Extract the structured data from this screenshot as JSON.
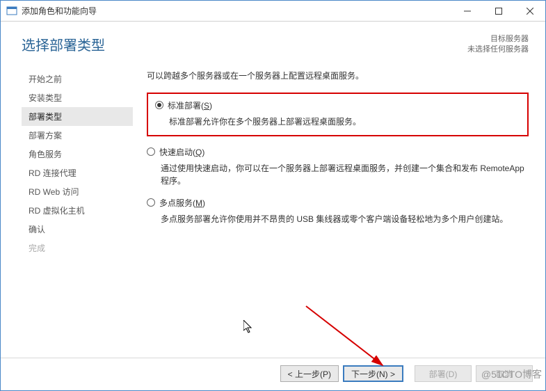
{
  "window": {
    "title": "添加角色和功能向导"
  },
  "header": {
    "page_title": "选择部署类型",
    "target_label": "目标服务器",
    "target_value": "未选择任何服务器"
  },
  "sidebar": {
    "items": [
      {
        "label": "开始之前",
        "state": "normal"
      },
      {
        "label": "安装类型",
        "state": "normal"
      },
      {
        "label": "部署类型",
        "state": "active"
      },
      {
        "label": "部署方案",
        "state": "normal"
      },
      {
        "label": "角色服务",
        "state": "normal"
      },
      {
        "label": "RD 连接代理",
        "state": "normal"
      },
      {
        "label": "RD Web 访问",
        "state": "normal"
      },
      {
        "label": "RD 虚拟化主机",
        "state": "normal"
      },
      {
        "label": "确认",
        "state": "normal"
      },
      {
        "label": "完成",
        "state": "disabled"
      }
    ]
  },
  "main": {
    "intro": "可以跨越多个服务器或在一个服务器上配置远程桌面服务。",
    "options": [
      {
        "label": "标准部署(",
        "hotkey": "S",
        "label_after": ")",
        "desc": "标准部署允许你在多个服务器上部署远程桌面服务。",
        "checked": true,
        "highlighted": true
      },
      {
        "label": "快速启动(",
        "hotkey": "Q",
        "label_after": ")",
        "desc": "通过使用快速启动，你可以在一个服务器上部署远程桌面服务，并创建一个集合和发布 RemoteApp 程序。",
        "checked": false,
        "highlighted": false
      },
      {
        "label": "多点服务(",
        "hotkey": "M",
        "label_after": ")",
        "desc": "多点服务部署允许你使用并不昂贵的 USB 集线器或零个客户端设备轻松地为多个用户创建站。",
        "checked": false,
        "highlighted": false
      }
    ]
  },
  "footer": {
    "prev": "< 上一步(P)",
    "next": "下一步(N) >",
    "deploy": "部署(D)",
    "cancel": "取消"
  },
  "watermark": "@51CTO博客"
}
